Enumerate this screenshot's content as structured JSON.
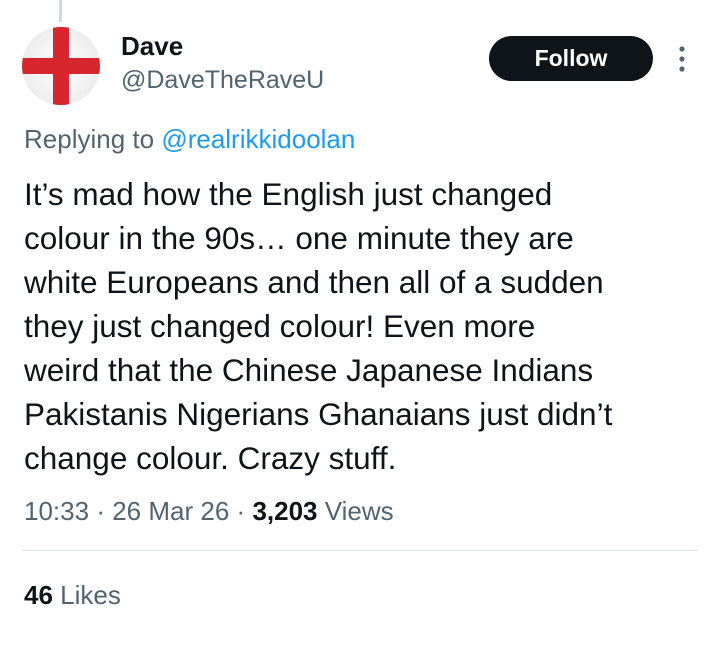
{
  "author": {
    "display_name": "Dave",
    "handle": "@DaveTheRaveU",
    "avatar": "england-flag-avatar"
  },
  "follow_label": "Follow",
  "more_icon": "more-vertical-icon",
  "reply": {
    "prefix": "Replying to",
    "mention": "@realrikkidoolan"
  },
  "tweet": {
    "lines": [
      "It’s mad how the English just changed",
      "colour in the 90s… one minute they are",
      "white Europeans and then all of a sudden",
      "they just changed colour! Even more",
      "weird that the Chinese Japanese Indians",
      "Pakistanis Nigerians Ghanaians just didn’t",
      "change colour. Crazy stuff."
    ]
  },
  "meta": {
    "time": "10:33",
    "date": "26 Mar 26",
    "separator": "·",
    "views_count": "3,203",
    "views_label": "Views"
  },
  "likes": {
    "count": "46",
    "label": "Likes"
  },
  "colors": {
    "text": "#0f1419",
    "secondary": "#536471",
    "link": "#1d9bf0",
    "button_bg": "#0f1419",
    "flag_red": "#d8262f"
  }
}
